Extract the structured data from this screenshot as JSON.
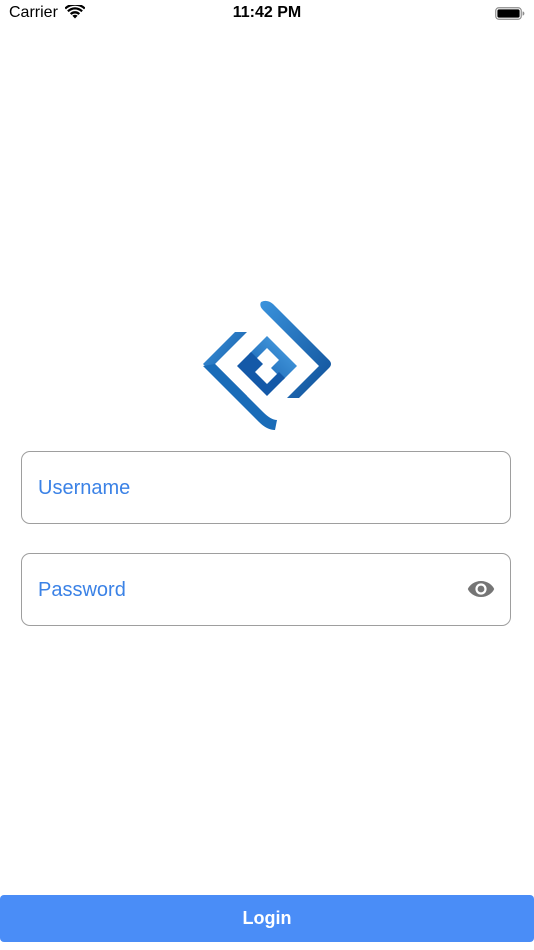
{
  "status_bar": {
    "carrier": "Carrier",
    "time": "11:42 PM",
    "wifi_icon": "wifi-icon",
    "battery_icon": "battery-icon"
  },
  "logo": {
    "icon": "interlocking-diamond-logo",
    "colors": [
      "#1565c0",
      "#2a7fd0",
      "#4aa0e6"
    ]
  },
  "form": {
    "username": {
      "placeholder": "Username",
      "value": ""
    },
    "password": {
      "placeholder": "Password",
      "value": "",
      "toggle_icon": "eye-icon"
    }
  },
  "login_button": {
    "label": "Login",
    "color": "#4a8df7"
  },
  "colors": {
    "placeholder": "#3b82e6",
    "field_border": "#9e9e9e",
    "eye_icon": "#757575"
  }
}
